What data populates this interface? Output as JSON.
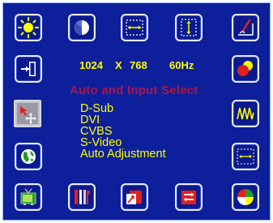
{
  "colors": {
    "panel_bg": "#0d1f9a",
    "text_yellow": "#ffff00",
    "title_magenta": "#a8184a",
    "selected_tile": "#9a9aa6"
  },
  "icons": {
    "top_row": [
      "brightness-icon",
      "contrast-icon",
      "horizontal-size-icon",
      "vertical-size-icon",
      "pencil-icon"
    ],
    "left_column": [
      "input-exit-icon",
      "auto-select-icon",
      "globe-language-icon"
    ],
    "right_column": [
      "color-icon",
      "waveform-icon",
      "horizontal-position-icon"
    ],
    "bottom_row": [
      "tv-icon",
      "tools-icon",
      "recall-icon",
      "swap-icon",
      "color-wheel-icon"
    ]
  },
  "status": {
    "resolution_w": "1024",
    "resolution_sep": "X",
    "resolution_h": "768",
    "refresh": "60Hz"
  },
  "menu": {
    "title": "Auto and Input Select",
    "selected_icon": "auto-select-icon",
    "options": [
      "D-Sub",
      "DVI",
      "CVBS",
      "S-Video",
      "Auto Adjustment"
    ]
  }
}
